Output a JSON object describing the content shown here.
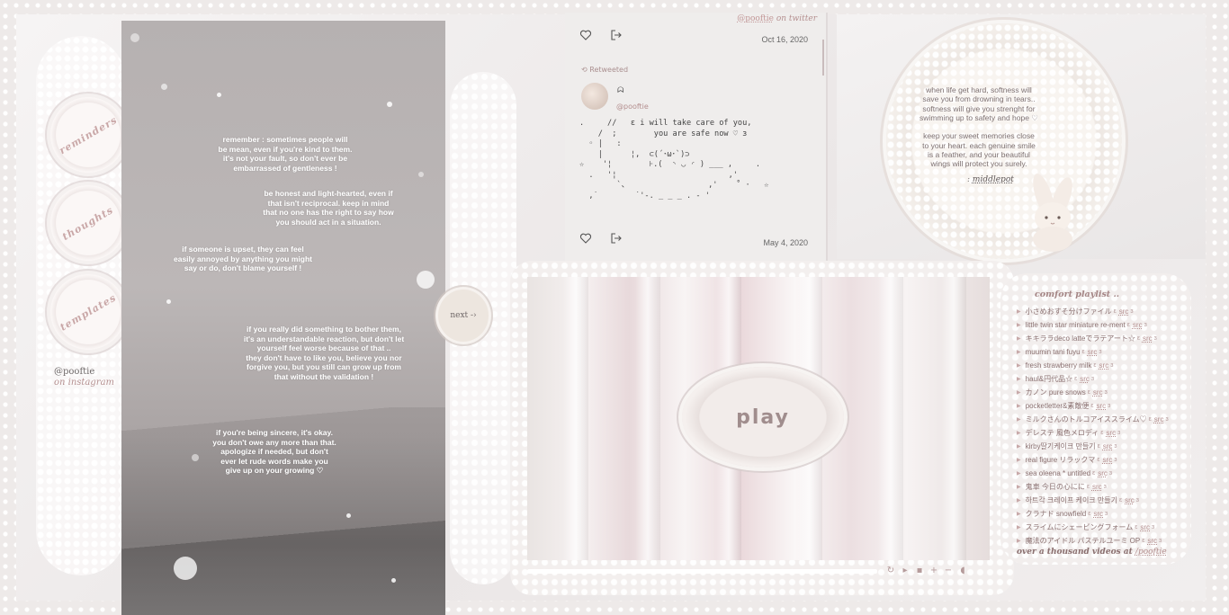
{
  "nav": {
    "items": [
      {
        "label": "reminders"
      },
      {
        "label": "thoughts"
      },
      {
        "label": "templates"
      }
    ],
    "instagram_handle": "@pooftie",
    "instagram_sub": "on instagram"
  },
  "quotes": {
    "q1": "remember : sometimes people will\nbe mean, even if you're kind to them.\nit's not your fault, so don't ever be\nembarrassed of gentleness !",
    "q2": "be honest and light-hearted, even if\nthat isn't reciprocal. keep in mind\nthat no one has the right to say how\nyou should act in a situation.",
    "q3": "if someone is upset, they can feel\neasily annoyed by anything you might\nsay or do, don't blame yourself !",
    "q4": "if you really did something to bother them,\nit's an understandable reaction, but don't let\nyourself feel worse because of that ..\nthey don't have to like you, believe you nor\nforgive you, but you still can grow up from\nthat without the validation !",
    "q5": "if you're being sincere, it's okay.\nyou don't owe any more than that.\napologize if needed, but don't\never let rude words make you\ngive up on your growing ♡"
  },
  "next_label": "next -›",
  "twitter": {
    "handle": "@pooftie",
    "credit_suffix": "on twitter",
    "top_date": "Oct 16, 2020",
    "retweeted_label": "⟲ Retweeted",
    "author_name": "ᗣ",
    "author_handle": "@pooftie",
    "ascii_art": ".     //   ε i will take care of you,\n    /  ;        you are safe now ♡ ɜ\n  ◦ |   :\n    |      ¦,  ⊂(´･ω･`)⊃\n☆    '¦        ⊦.(  ◝ ◡ ◜ ) ___ ,     .\n  .   '¦                        ,'\n        `、                 ,'    ˚ ·   ☆\n  ,˙        ˙'-. _ _ _ . - '",
    "bottom_date": "May 4, 2020"
  },
  "soft_quote": {
    "text": "when life get hard, softness will\nsave you from drowning in tears..\nsoftness will give you strenght for\nswimming up to safety and hope ♡\n\nkeep your sweet memories close\nto your heart. each genuine smile\nis a feather, and your beautiful\nwings will protect you surely.",
    "credit_prefix": "ː",
    "credit_name": "middlepot"
  },
  "player": {
    "play_label": "play",
    "progress": 0.76,
    "controls": [
      "repeat-icon",
      "play-icon",
      "stop-icon",
      "plus-icon",
      "minus-icon",
      "volume-icon"
    ]
  },
  "playlist": {
    "title": "comfort playlist ..",
    "items": [
      "小さめおすそ分けファイル",
      "little twin star miniature re-ment",
      "キキララdeco latteでラテアート☆",
      "muumin tani fuyu",
      "fresh strawberry milk",
      "haul&円代品☆",
      "カノン pure snows",
      "pocketletter&素敵便",
      "ミルクさんのトルコアイススライム♡",
      "デレステ 風色メロディ",
      "kirby딸기케이크 만들기",
      "real figure リラックマ",
      "sea oleena * untitled",
      "鬼車 今日の心にに",
      "하트각 크레이프 케이크 만들기",
      "クラナド snowfield",
      "スライムにシェービングフォーム",
      "魔法のアイドル パステルユーミ OP"
    ],
    "src_label": "src",
    "open_bracket": "ε",
    "close_bracket": "ɜ",
    "footer_prefix": "over a thousand videos at",
    "footer_handle": "/pooftie"
  },
  "colors": {
    "accent": "#b48f8f",
    "background": "#f2efee"
  }
}
